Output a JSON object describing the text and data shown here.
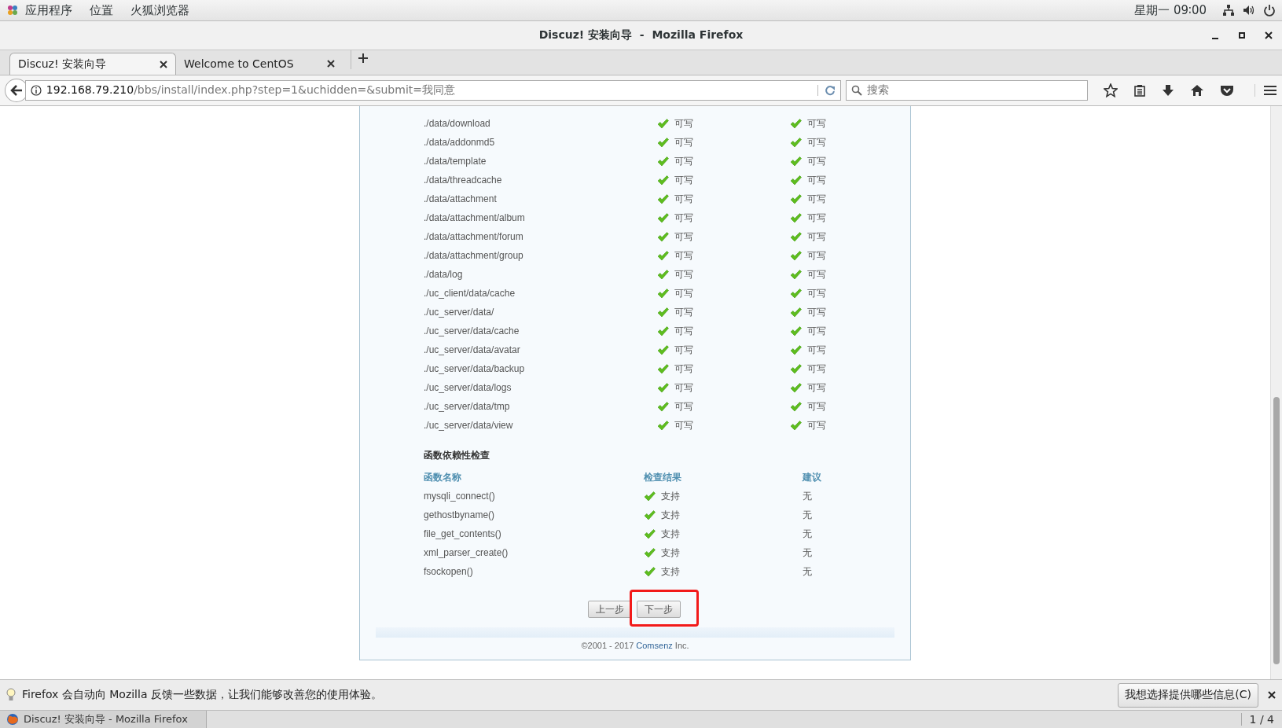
{
  "top_bar": {
    "menus": [
      "应用程序",
      "位置",
      "火狐浏览器"
    ],
    "clock": "星期一 09∶00"
  },
  "window": {
    "title": "Discuz! 安装向导  -  Mozilla Firefox"
  },
  "tabs": [
    {
      "label": "Discuz! 安装向导",
      "selected": true
    },
    {
      "label": "Welcome to CentOS",
      "selected": false
    }
  ],
  "address_bar": {
    "host": "192.168.79.210",
    "path": "/bbs/install/index.php?step=1&uchidden=&submit=我同意"
  },
  "search": {
    "placeholder": "搜索"
  },
  "directory_check": {
    "rows": [
      {
        "path": "./data/download",
        "current": "可写",
        "required": "可写"
      },
      {
        "path": "./data/addonmd5",
        "current": "可写",
        "required": "可写"
      },
      {
        "path": "./data/template",
        "current": "可写",
        "required": "可写"
      },
      {
        "path": "./data/threadcache",
        "current": "可写",
        "required": "可写"
      },
      {
        "path": "./data/attachment",
        "current": "可写",
        "required": "可写"
      },
      {
        "path": "./data/attachment/album",
        "current": "可写",
        "required": "可写"
      },
      {
        "path": "./data/attachment/forum",
        "current": "可写",
        "required": "可写"
      },
      {
        "path": "./data/attachment/group",
        "current": "可写",
        "required": "可写"
      },
      {
        "path": "./data/log",
        "current": "可写",
        "required": "可写"
      },
      {
        "path": "./uc_client/data/cache",
        "current": "可写",
        "required": "可写"
      },
      {
        "path": "./uc_server/data/",
        "current": "可写",
        "required": "可写"
      },
      {
        "path": "./uc_server/data/cache",
        "current": "可写",
        "required": "可写"
      },
      {
        "path": "./uc_server/data/avatar",
        "current": "可写",
        "required": "可写"
      },
      {
        "path": "./uc_server/data/backup",
        "current": "可写",
        "required": "可写"
      },
      {
        "path": "./uc_server/data/logs",
        "current": "可写",
        "required": "可写"
      },
      {
        "path": "./uc_server/data/tmp",
        "current": "可写",
        "required": "可写"
      },
      {
        "path": "./uc_server/data/view",
        "current": "可写",
        "required": "可写"
      }
    ]
  },
  "function_check": {
    "title": "函数依赖性检查",
    "columns": [
      "函数名称",
      "检查结果",
      "建议"
    ],
    "rows": [
      {
        "name": "mysqli_connect()",
        "result": "支持",
        "advice": "无"
      },
      {
        "name": "gethostbyname()",
        "result": "支持",
        "advice": "无"
      },
      {
        "name": "file_get_contents()",
        "result": "支持",
        "advice": "无"
      },
      {
        "name": "xml_parser_create()",
        "result": "支持",
        "advice": "无"
      },
      {
        "name": "fsockopen()",
        "result": "支持",
        "advice": "无"
      }
    ]
  },
  "buttons": [
    {
      "label": "上一步",
      "highlighted": false
    },
    {
      "label": "下一步",
      "highlighted": true
    }
  ],
  "footer": {
    "copyright": "©2001 - 2017",
    "link": "Comsenz",
    "suffix": "Inc."
  },
  "notification": {
    "text": "Firefox 会自动向 Mozilla 反馈一些数据，让我们能够改善您的使用体验。",
    "button": "我想选择提供哪些信息(C)"
  },
  "taskbar": {
    "window": "Discuz! 安装向导 - Mozilla Firefox",
    "workspace": "1 / 4"
  }
}
